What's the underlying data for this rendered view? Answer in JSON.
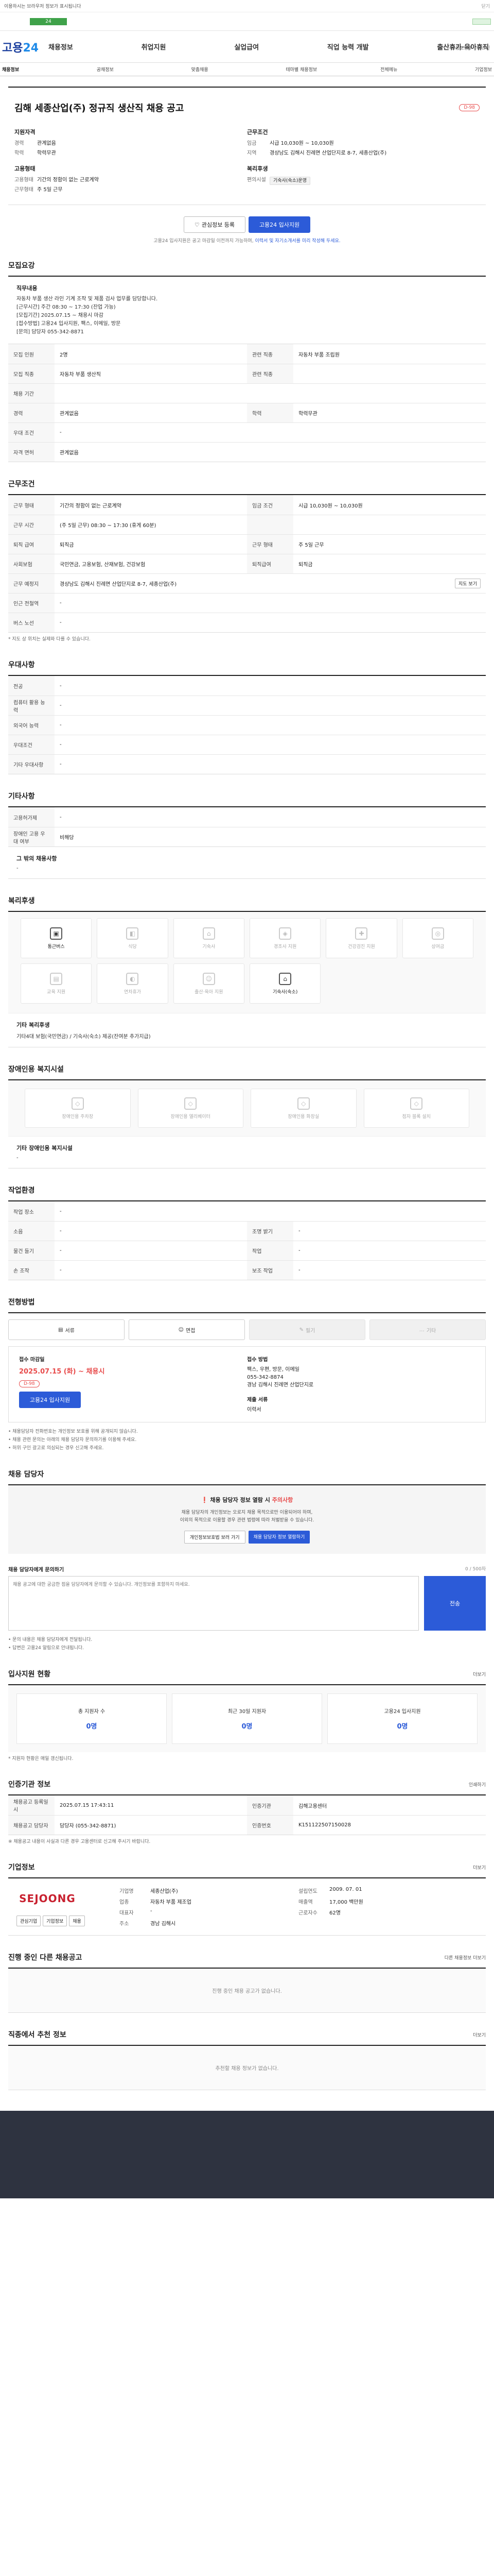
{
  "notice": {
    "text": "이용하시는 브라우저 정보가 표시됩니다",
    "close": "닫기"
  },
  "util": {
    "text": "고용노동부 | 로그인"
  },
  "logo": {
    "a": "고용",
    "b": "24"
  },
  "gnb": [
    "채용정보",
    "취업지원",
    "실업급여",
    "직업 능력 개발",
    "출산휴가·육아휴직"
  ],
  "lnb": [
    "채용정보",
    "공채정보",
    "맞춤채용",
    "테마별 채용정보",
    "전체메뉴",
    "기업정보"
  ],
  "header": {
    "company": "",
    "title": "김해 세종산업(주) 정규직 생산직 채용 공고",
    "dday": "D-98",
    "left_title": "지원자격",
    "left": [
      {
        "k": "경력",
        "v": "관계없음"
      },
      {
        "k": "학력",
        "v": "학력무관"
      }
    ],
    "left2_title": "고용형태",
    "left2": [
      {
        "k": "고용형태",
        "v": "기간의 정함이 없는 근로계약"
      },
      {
        "k": "근무형태",
        "v": "주 5일 근무"
      }
    ],
    "right_title": "근무조건",
    "right": [
      {
        "k": "임금",
        "v": "시급 10,030원 ~ 10,030원"
      },
      {
        "k": "지역",
        "v": "경상남도 김해시 진례면 산업단지로 8-7, 세종산업(주)"
      }
    ],
    "right2_title": "복리후생",
    "right2_k": "편의시설",
    "right2_badge": "기숙사(숙소)운영",
    "scrap": "관심정보 등록",
    "apply": "고용24 입사지원",
    "actnote_a": "고용24 입사지원은 공고 마감일 이전까지 가능하며,",
    "actnote_b": "이력서 및 자기소개서를 미리 작성해 두세요."
  },
  "job": {
    "title": "모집요강",
    "desc_h": "직무내용",
    "desc": "자동차 부품 생산 라인 기계 조작 및 제품 검사 업무를 담당합니다.\n[근무시간] 주간 08:30 ~ 17:30 (잔업 가능)\n[모집기간] 2025.07.15 ~ 채용시 마감\n[접수방법] 고용24 입사지원, 팩스, 이메일, 방문\n[문의] 담당자 055-342-8871",
    "rows": [
      [
        {
          "k": "모집 인원",
          "v": "2명"
        },
        {
          "k": "관련 직종",
          "v": "자동차 부품 조립원"
        }
      ],
      [
        {
          "k": "모집 직종",
          "v": "자동차 부품 생산직"
        },
        {
          "k": "관련 직종",
          "v": ""
        }
      ],
      [
        {
          "k": "채용 기간",
          "v": ""
        }
      ],
      [
        {
          "k": "경력",
          "v": "관계없음"
        },
        {
          "k": "학력",
          "v": "학력무관"
        }
      ],
      [
        {
          "k": "우대 조건",
          "v": "-"
        }
      ],
      [
        {
          "k": "자격 면허",
          "v": "관계없음"
        }
      ]
    ]
  },
  "cond": {
    "title": "근무조건",
    "rows": [
      [
        {
          "k": "근무 형태",
          "v": "기간의 정함이 없는 근로계약"
        },
        {
          "k": "임금 조건",
          "v": "시급 10,030원 ~ 10,030원"
        }
      ],
      [
        {
          "k": "근무 시간",
          "v": "(주 5일 근무) 08:30 ~ 17:30 (휴게 60분)"
        },
        {
          "k": "",
          "v": ""
        }
      ],
      [
        {
          "k": "퇴직 급여",
          "v": "퇴직금"
        },
        {
          "k": "근무 형태",
          "v": "주 5일 근무"
        }
      ],
      [
        {
          "k": "사회보험",
          "v": "국민연금, 고용보험, 산재보험, 건강보험"
        },
        {
          "k": "퇴직급여",
          "v": "퇴직금"
        }
      ],
      [
        {
          "k": "근무 예정지",
          "v": "경상남도 김해시 진례면 산업단지로 8-7, 세종산업(주)"
        }
      ],
      [
        {
          "k": "인근 전철역",
          "v": "-"
        }
      ],
      [
        {
          "k": "버스 노선",
          "v": "-"
        }
      ]
    ],
    "map_btn": "지도 보기",
    "note": "* 지도 상 위치는 실제와 다를 수 있습니다."
  },
  "pref": {
    "title": "우대사항",
    "rows": [
      {
        "k": "전공",
        "v": "-"
      },
      {
        "k": "컴퓨터 활용 능력",
        "v": "-"
      },
      {
        "k": "외국어 능력",
        "v": "-"
      },
      {
        "k": "우대조건",
        "v": "-"
      },
      {
        "k": "기타 우대사항",
        "v": "-"
      }
    ]
  },
  "etc": {
    "title": "기타사항",
    "rows": [
      {
        "k": "고용허가제",
        "v": "-"
      },
      {
        "k": "장애인 고용 우대 여부",
        "v": "비해당"
      }
    ],
    "addl_h": "그 밖의 채용사항",
    "addl": "-"
  },
  "welfare": {
    "title": "복리후생",
    "cards": [
      {
        "icon": "bus-icon",
        "g": "▣",
        "label": "통근버스",
        "on": true
      },
      {
        "icon": "meal-icon",
        "g": "◧",
        "label": "식당",
        "on": false
      },
      {
        "icon": "dorm-icon",
        "g": "⌂",
        "label": "기숙사",
        "on": false
      },
      {
        "icon": "gift-icon",
        "g": "◈",
        "label": "경조사 지원",
        "on": false
      },
      {
        "icon": "health-icon",
        "g": "✚",
        "label": "건강검진 지원",
        "on": false
      },
      {
        "icon": "bonus-icon",
        "g": "◎",
        "label": "상여금",
        "on": false
      },
      {
        "icon": "edu-icon",
        "g": "▤",
        "label": "교육 지원",
        "on": false
      },
      {
        "icon": "leave-icon",
        "g": "◐",
        "label": "연차휴가",
        "on": false
      },
      {
        "icon": "child-icon",
        "g": "☺",
        "label": "출산·육아 지원",
        "on": false
      },
      {
        "icon": "house-icon",
        "g": "⌂",
        "label": "기숙사(숙소)",
        "on": true
      }
    ],
    "other_h": "기타 복리후생",
    "other": "기타4대 보험(국민연금) / 기숙사(숙소) 제공(잔여분 추가지급)"
  },
  "disab": {
    "title": "장애인용 복지시설",
    "cards": [
      {
        "label": "장애인용 주차장"
      },
      {
        "label": "장애인용 엘리베이터"
      },
      {
        "label": "장애인용 화장실"
      },
      {
        "label": "점자 블록 설치"
      }
    ],
    "other_h": "기타 장애인용 복지시설",
    "other": "-"
  },
  "env": {
    "title": "작업환경",
    "rows": [
      [
        {
          "k": "작업 장소",
          "v": "-"
        }
      ],
      [
        {
          "k": "소음",
          "v": "-"
        },
        {
          "k": "조명 밝기",
          "v": "-"
        }
      ],
      [
        {
          "k": "물건 들기",
          "v": "-"
        },
        {
          "k": "작업",
          "v": "-"
        }
      ],
      [
        {
          "k": "손 조작",
          "v": "-"
        },
        {
          "k": "보조 작업",
          "v": "-"
        }
      ]
    ]
  },
  "apply": {
    "title": "전형방법",
    "methods": [
      {
        "label": "서류",
        "off": false
      },
      {
        "label": "면접",
        "off": false
      },
      {
        "label": "필기",
        "off": true
      },
      {
        "label": "기타",
        "off": true
      }
    ],
    "period_h": "접수 마감일",
    "period": "2025.07.15 (화) ~ 채용시",
    "dday": "D-98",
    "btn": "고용24 입사지원",
    "how_h": "접수 방법",
    "how": "팩스, 우편, 방문, 이메일\n055-342-8874\n경남 김해시 진례면 산업단지로",
    "docs_h": "제출 서류",
    "docs": "이력서",
    "bullets": [
      "채용담당자 전화번호는 개인정보 보호를 위해 공개되지 않습니다.",
      "채용 관련 문의는 아래의 채용 담당자 문의하기를 이용해 주세요.",
      "허위 구인 광고로 의심되는 경우 신고해 주세요."
    ]
  },
  "contact": {
    "title": "채용 담당자",
    "warn_a": "채용 담당자 정보 열람 시 ",
    "warn_b": "주의사항",
    "body": "채용 담당자의 개인정보는 오로지 채용 목적으로만 이용되어야 하며,\n이외의 목적으로 이용할 경우 관련 법령에 따라 처벌받을 수 있습니다.",
    "btn1": "개인정보보호법 보러 가기",
    "btn2": "채용 담당자 정보 열람하기",
    "qlabel": "채용 담당자에게 문의하기",
    "qcount": "0 / 500자",
    "qplaceholder": "채용 공고에 대한 궁금한 점을 담당자에게 문의할 수 있습니다. 개인정보를 포함하지 마세요.",
    "qsend": "전송",
    "qnotes": [
      "문의 내용은 채용 담당자에게 전달됩니다.",
      "답변은 고용24 알림으로 안내됩니다."
    ]
  },
  "stats": {
    "title": "입사지원 현황",
    "more": "더보기",
    "items": [
      {
        "l": "총 지원자 수",
        "v": "0명"
      },
      {
        "l": "최근 30일 지원자",
        "v": "0명"
      },
      {
        "l": "고용24 입사지원",
        "v": "0명"
      }
    ],
    "note": "* 지원자 현황은 매일 갱신됩니다."
  },
  "reginfo": {
    "title": "인증기관 정보",
    "more": "인쇄하기",
    "rows": [
      [
        {
          "k": "채용공고 등록일시",
          "v": "2025.07.15 17:43:11"
        },
        {
          "k": "인증기관",
          "v": "김해고용센터"
        }
      ],
      [
        {
          "k": "채용공고 담당자",
          "v": "담당자 (055-342-8871)"
        },
        {
          "k": "인증번호",
          "v": "K151122507150028"
        }
      ]
    ],
    "note": "※ 채용공고 내용이 사실과 다른 경우 고용센터로 신고해 주시기 바랍니다."
  },
  "corp": {
    "title": "기업정보",
    "more": "더보기",
    "logo": "SEJOONG",
    "btn1": "관심기업",
    "btn2": "기업정보",
    "btn3": "채용",
    "info": [
      {
        "k": "기업명",
        "v": "세종산업(주)"
      },
      {
        "k": "설립연도",
        "v": "2009. 07. 01"
      },
      {
        "k": "업종",
        "v": "자동차 부품 제조업"
      },
      {
        "k": "매출액",
        "v": "17,000 백만원"
      },
      {
        "k": "대표자",
        "v": "-"
      },
      {
        "k": "근로자수",
        "v": "62명"
      },
      {
        "k": "주소",
        "v": "경남 김해시"
      },
      {
        "k": "",
        "v": ""
      }
    ]
  },
  "ongoing": {
    "title": "진행 중인 다른 채용공고",
    "more": "다른 채용정보 더보기",
    "empty": "진행 중인 채용 공고가 없습니다."
  },
  "similar": {
    "title": "직종에서 추천 정보",
    "more": "더보기",
    "empty": "추천할 채용 정보가 없습니다."
  }
}
